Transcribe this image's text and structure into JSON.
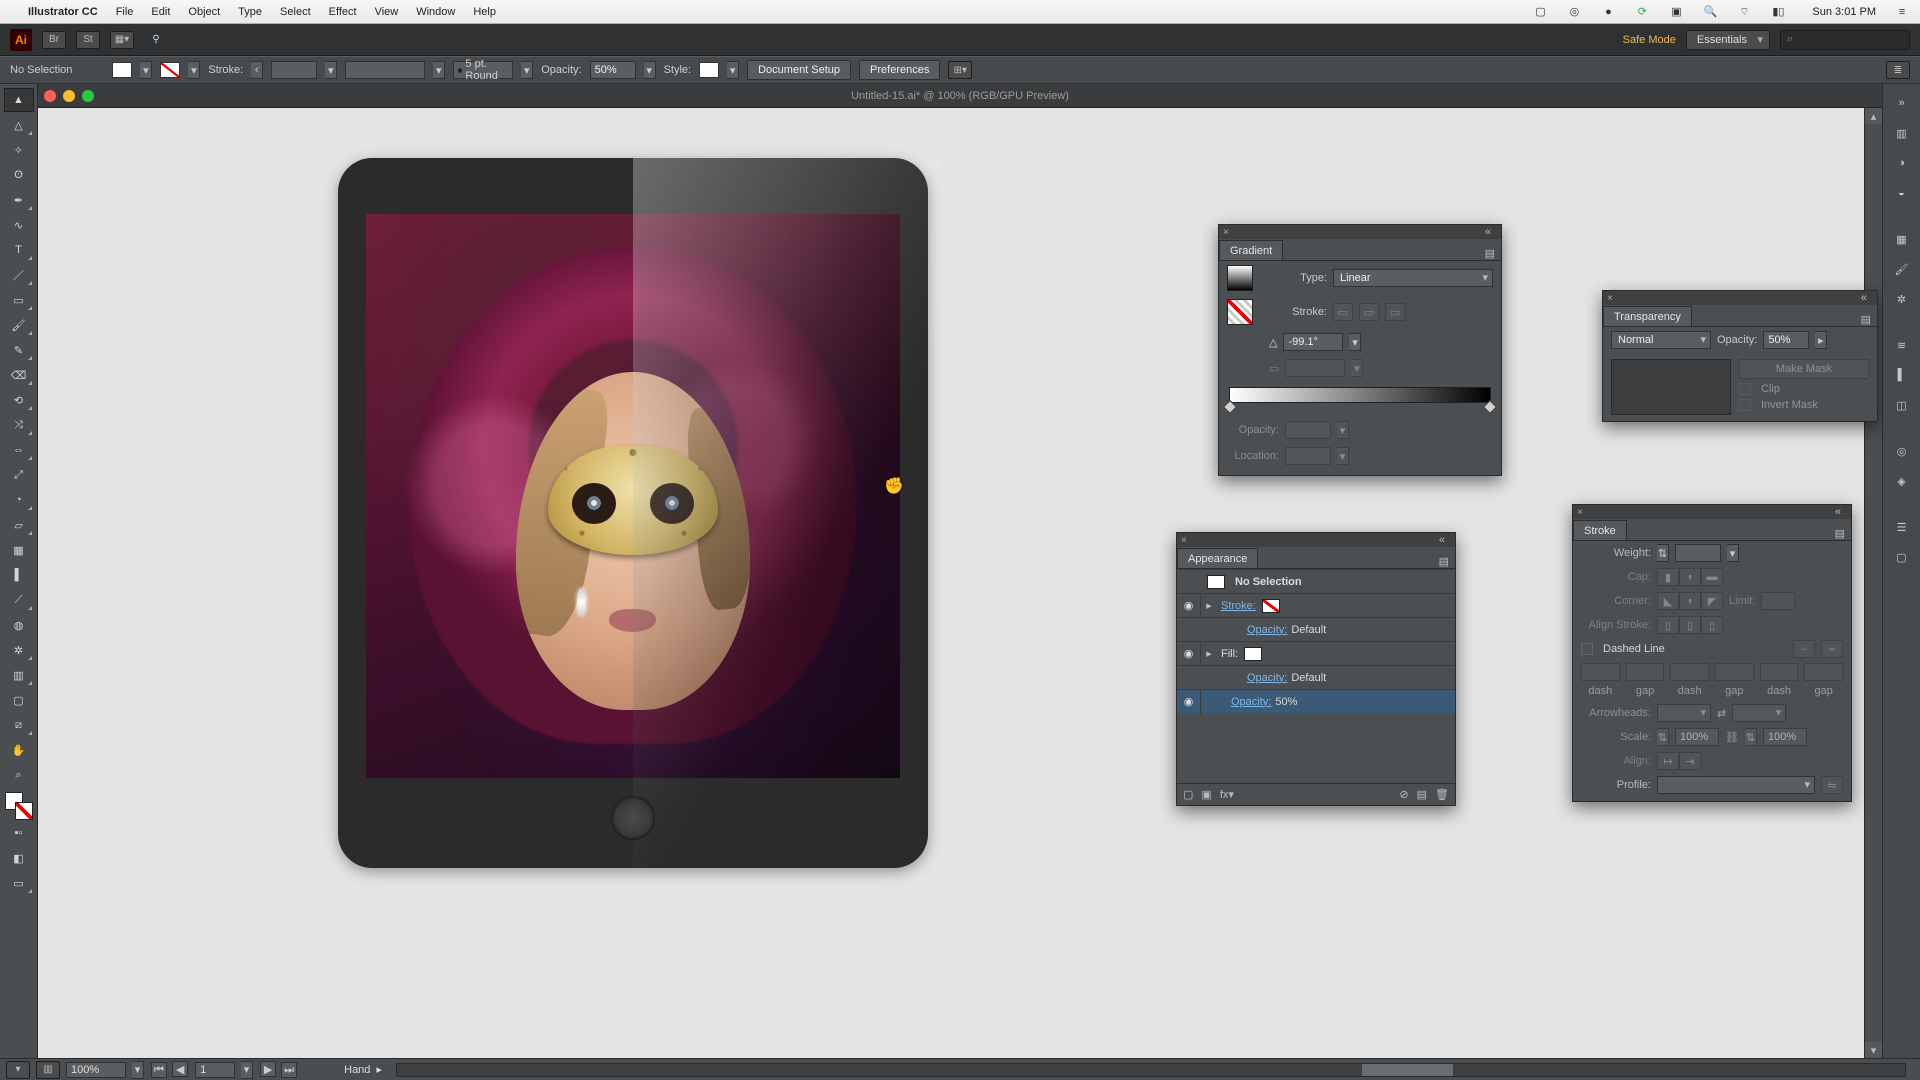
{
  "mac": {
    "apple": "",
    "appname": "Illustrator CC",
    "menus": [
      "File",
      "Edit",
      "Object",
      "Type",
      "Select",
      "Effect",
      "View",
      "Window",
      "Help"
    ],
    "clock": "Sun 3:01 PM"
  },
  "topbar": {
    "safemode": "Safe Mode",
    "workspace": "Essentials"
  },
  "control": {
    "selection_state": "No Selection",
    "stroke_label": "Stroke:",
    "stroke_weight": "",
    "brush": "5 pt. Round",
    "opacity_label": "Opacity:",
    "opacity_value": "50%",
    "style_label": "Style:",
    "doc_setup": "Document Setup",
    "preferences": "Preferences"
  },
  "doc": {
    "title": "Untitled-15.ai* @ 100% (RGB/GPU Preview)"
  },
  "gradient": {
    "title": "Gradient",
    "type_label": "Type:",
    "type_value": "Linear",
    "stroke_label": "Stroke:",
    "angle_value": "-99.1°",
    "ratio_value": "",
    "opacity_label": "Opacity:",
    "opacity_value": "",
    "location_label": "Location:",
    "location_value": ""
  },
  "appearance": {
    "title": "Appearance",
    "object": "No Selection",
    "rows": {
      "stroke_label": "Stroke:",
      "stroke_opacity_label": "Opacity:",
      "stroke_opacity_value": "Default",
      "fill_label": "Fill:",
      "fill_opacity_label": "Opacity:",
      "fill_opacity_value": "Default",
      "obj_opacity_label": "Opacity:",
      "obj_opacity_value": "50%"
    }
  },
  "transparency": {
    "title": "Transparency",
    "mode": "Normal",
    "opacity_label": "Opacity:",
    "opacity_value": "50%",
    "makemask": "Make Mask",
    "clip": "Clip",
    "invert": "Invert Mask"
  },
  "stroke": {
    "title": "Stroke",
    "weight_label": "Weight:",
    "weight_value": "",
    "cap_label": "Cap:",
    "corner_label": "Corner:",
    "limit_label": "Limit:",
    "limit_value": "",
    "align_label": "Align Stroke:",
    "dashed_label": "Dashed Line",
    "dash_labels": [
      "dash",
      "gap",
      "dash",
      "gap",
      "dash",
      "gap"
    ],
    "arrow_label": "Arrowheads:",
    "scale_label": "Scale:",
    "scale_a": "100%",
    "scale_b": "100%",
    "alignarrow_label": "Align:",
    "profile_label": "Profile:"
  },
  "status": {
    "zoom": "100%",
    "artboard": "1",
    "tool": "Hand"
  }
}
